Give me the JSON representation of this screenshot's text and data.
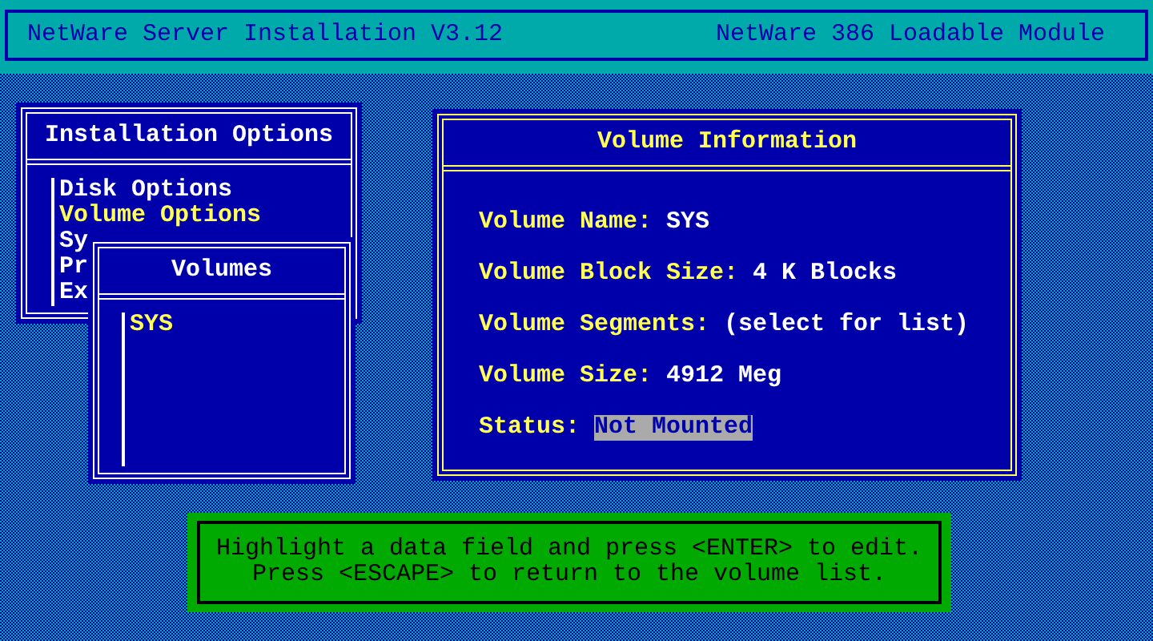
{
  "header": {
    "title": "NetWare Server Installation V3.12",
    "module": "NetWare 386 Loadable Module"
  },
  "installation_options": {
    "title": "Installation Options",
    "items": [
      {
        "label": "Disk Options",
        "selected": false
      },
      {
        "label": "Volume Options",
        "selected": true
      },
      {
        "label": "Sy",
        "selected": false
      },
      {
        "label": "Pr",
        "selected": false
      },
      {
        "label": "Ex",
        "selected": false
      }
    ]
  },
  "volumes": {
    "title": "Volumes",
    "items": [
      {
        "label": "SYS",
        "selected": true
      }
    ]
  },
  "volume_information": {
    "title": "Volume Information",
    "fields": [
      {
        "label": "Volume Name:",
        "value": "SYS",
        "highlighted": false
      },
      {
        "label": "Volume Block Size:",
        "value": "4 K Blocks",
        "highlighted": false
      },
      {
        "label": "Volume Segments:",
        "value": "(select for list)",
        "highlighted": false
      },
      {
        "label": "Volume Size:",
        "value": "4912 Meg",
        "highlighted": false
      },
      {
        "label": "Status:",
        "value": "Not Mounted",
        "highlighted": true
      }
    ]
  },
  "help": {
    "lines": [
      "Highlight a data field and press <ENTER> to edit.",
      "Press <ESCAPE> to return to the volume list."
    ]
  }
}
